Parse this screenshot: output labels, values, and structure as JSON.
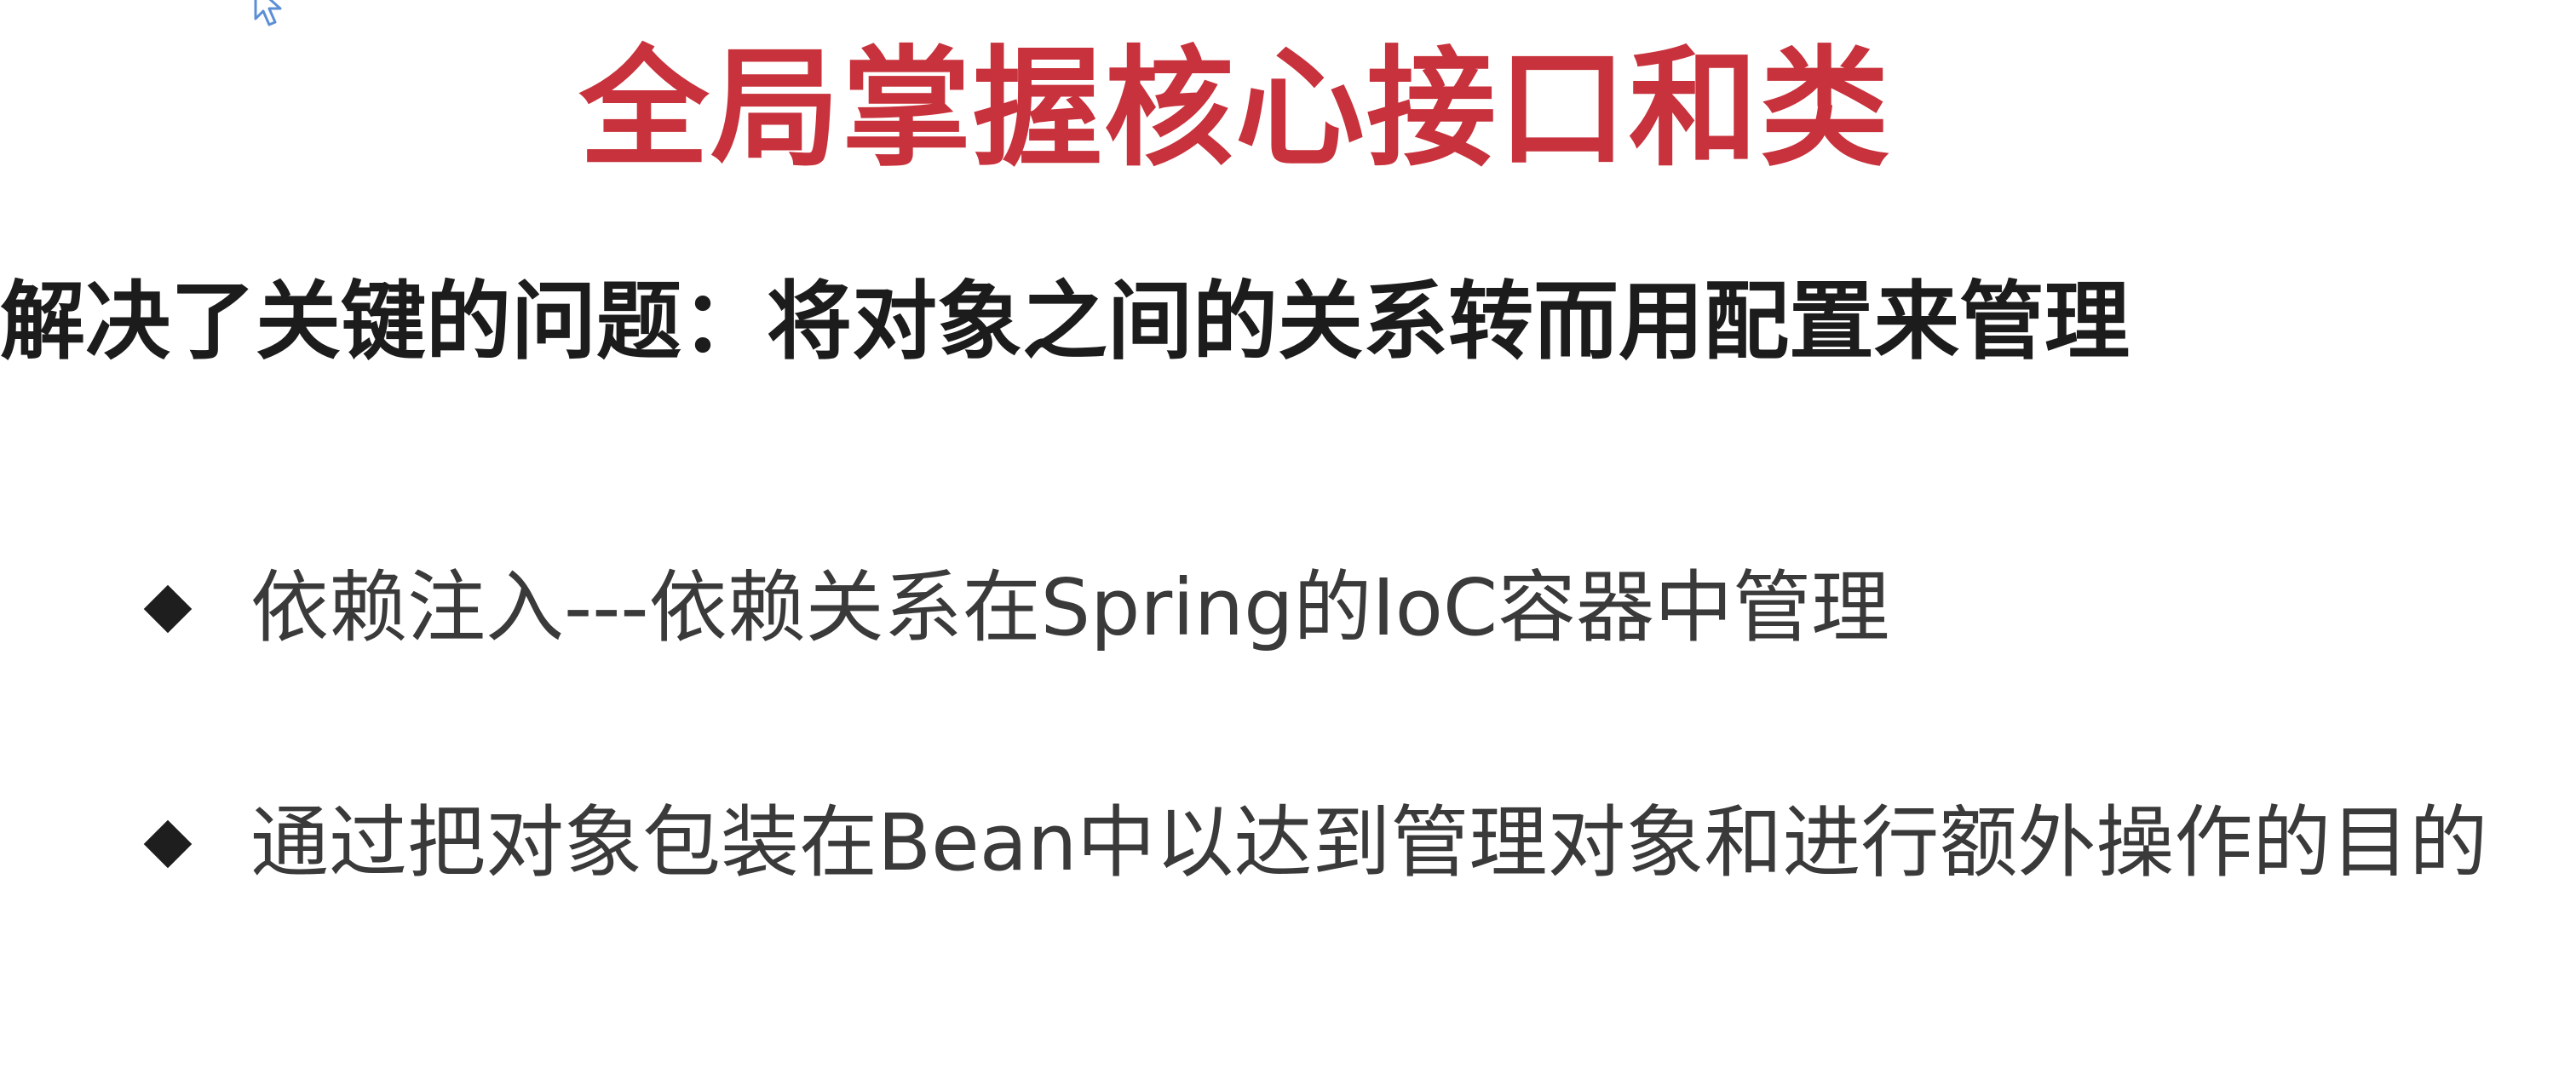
{
  "colors": {
    "title": "#c8323c",
    "subtitle": "#1c1c1c",
    "bullet_text": "#3a3a3a",
    "cursor": "#5b8fd6"
  },
  "slide": {
    "title": "全局掌握核心接口和类",
    "subtitle": "解决了关键的问题：将对象之间的关系转而用配置来管理",
    "bullets": [
      {
        "icon": "diamond-bullet-icon",
        "text": "依赖注入---依赖关系在Spring的IoC容器中管理"
      },
      {
        "icon": "diamond-bullet-icon",
        "text": "通过把对象包装在Bean中以达到管理对象和进行额外操作的目的"
      }
    ]
  },
  "cursor": {
    "icon": "mouse-pointer-icon"
  }
}
